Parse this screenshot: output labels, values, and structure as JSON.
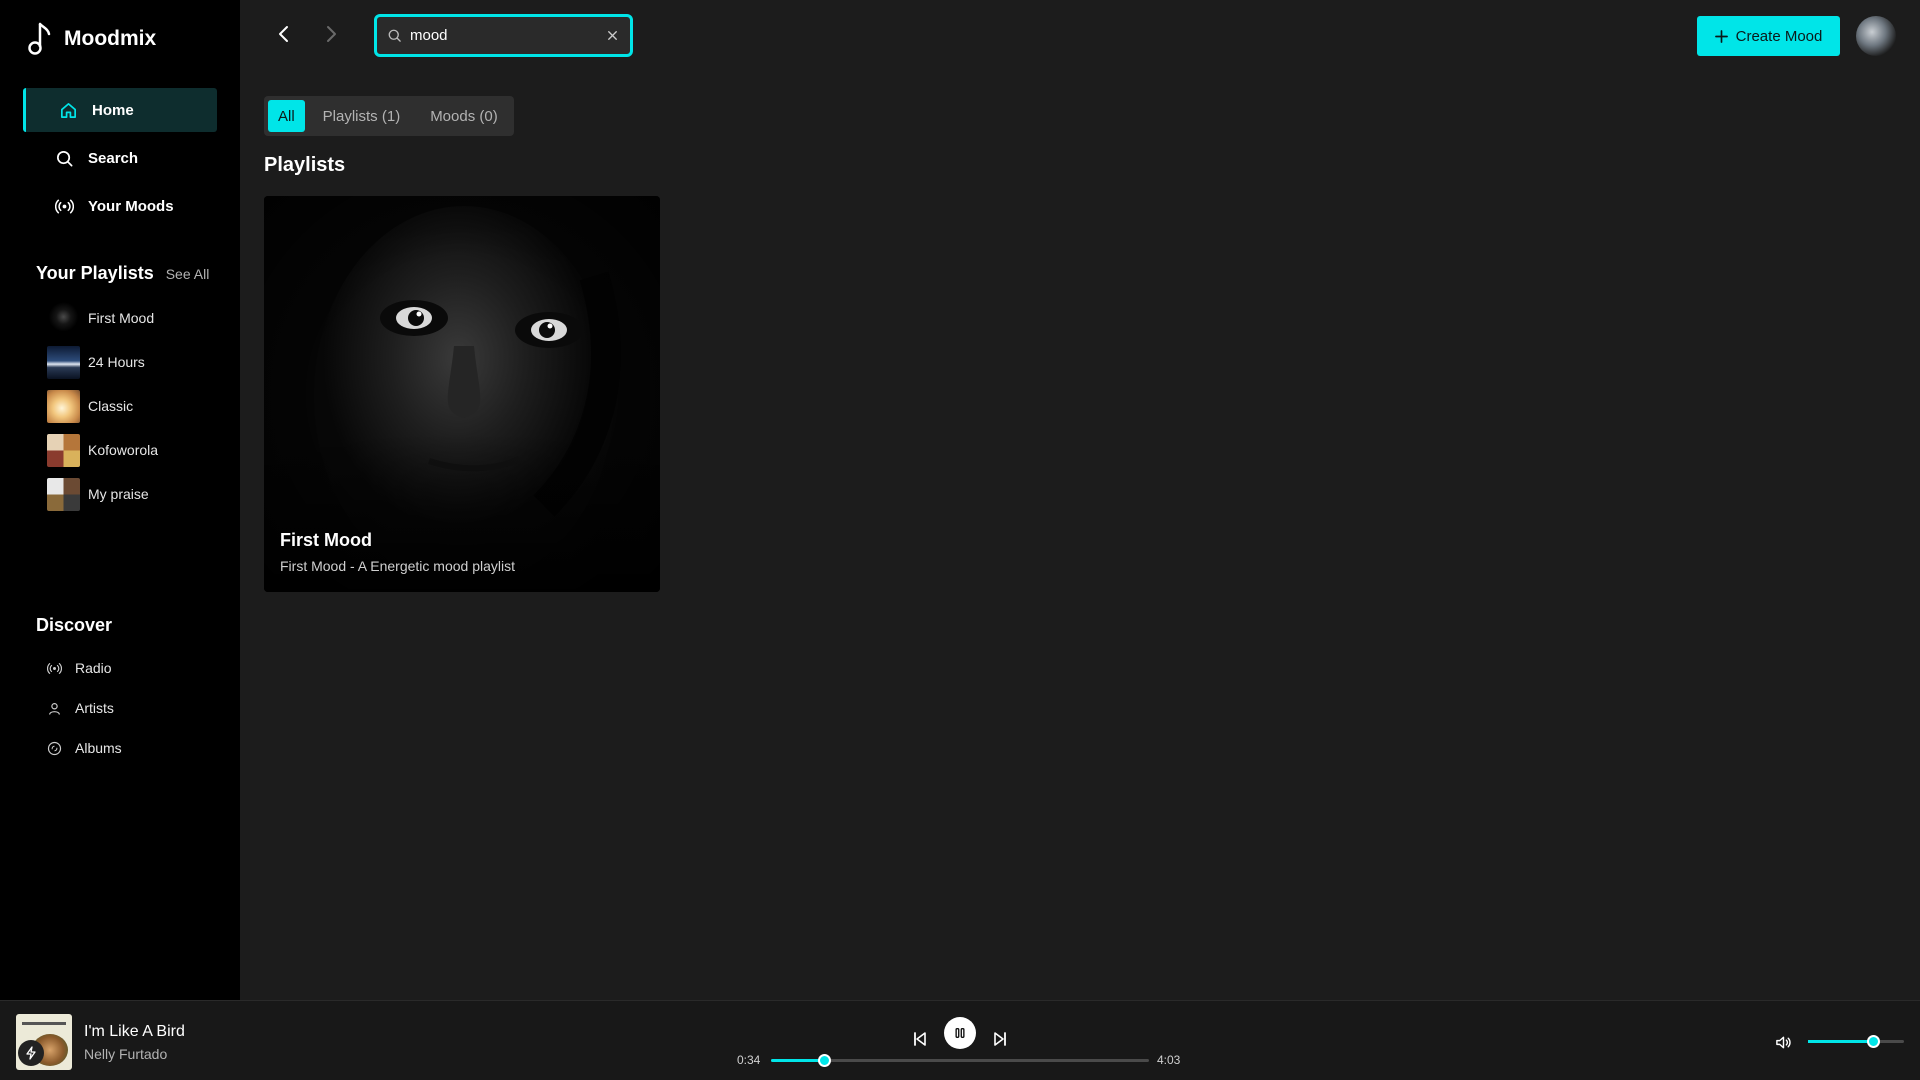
{
  "app": {
    "name": "Moodmix"
  },
  "nav": {
    "items": [
      {
        "label": "Home",
        "icon": "home-icon",
        "active": true
      },
      {
        "label": "Search",
        "icon": "search-icon",
        "active": false
      },
      {
        "label": "Your Moods",
        "icon": "broadcast-icon",
        "active": false
      }
    ]
  },
  "playlists_section": {
    "title": "Your Playlists",
    "see_all": "See All",
    "items": [
      {
        "label": "First Mood"
      },
      {
        "label": "24 Hours"
      },
      {
        "label": "Classic"
      },
      {
        "label": "Kofoworola"
      },
      {
        "label": "My praise"
      }
    ]
  },
  "discover": {
    "title": "Discover",
    "items": [
      {
        "label": "Radio",
        "icon": "radio-icon"
      },
      {
        "label": "Artists",
        "icon": "user-icon"
      },
      {
        "label": "Albums",
        "icon": "album-icon"
      }
    ]
  },
  "search": {
    "value": "mood"
  },
  "header": {
    "create_label": "Create Mood"
  },
  "filters": [
    {
      "label": "All",
      "active": true
    },
    {
      "label": "Playlists (1)",
      "active": false
    },
    {
      "label": "Moods (0)",
      "active": false
    }
  ],
  "results": {
    "heading": "Playlists",
    "cards": [
      {
        "title": "First Mood",
        "subtitle": "First Mood - A Energetic mood playlist"
      }
    ]
  },
  "player": {
    "title": "I'm Like A Bird",
    "artist": "Nelly Furtado",
    "elapsed": "0:34",
    "duration": "4:03",
    "progress_fraction": 0.14,
    "volume_fraction": 0.68,
    "state": "playing"
  },
  "colors": {
    "accent": "#00e5e8",
    "sidebar": "#000000",
    "main": "#1c1c1c"
  }
}
